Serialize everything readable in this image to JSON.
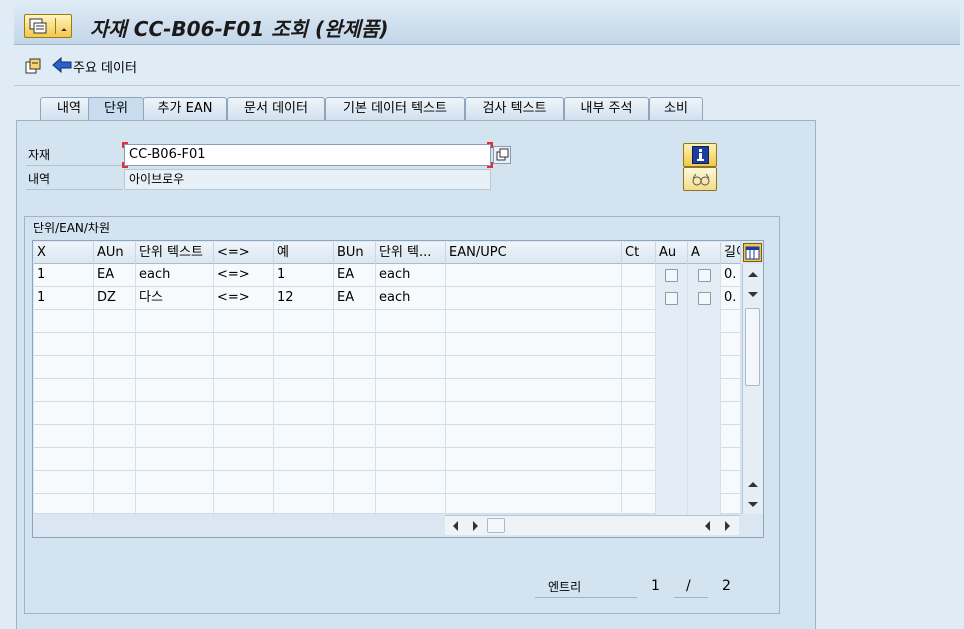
{
  "title": "자재 CC-B06-F01 조회 (완제품)",
  "toolbar": {
    "main_data_label": "주요 데이터"
  },
  "tabs": [
    {
      "label": "내역"
    },
    {
      "label": "단위"
    },
    {
      "label": "추가 EAN"
    },
    {
      "label": "문서 데이터"
    },
    {
      "label": "기본 데이터 텍스트"
    },
    {
      "label": "검사 텍스트"
    },
    {
      "label": "내부 주석"
    },
    {
      "label": "소비"
    }
  ],
  "active_tab": "단위",
  "fields": {
    "material_label": "자재",
    "material_value": "CC-B06-F01",
    "description_label": "내역",
    "description_value": "아이브로우"
  },
  "group": {
    "title": "단위/EAN/차원"
  },
  "table": {
    "columns": [
      "X",
      "AUn",
      "단위 텍스트",
      "<=>",
      "예",
      "BUn",
      "단위 텍...",
      "EAN/UPC",
      "Ct",
      "Au",
      "A",
      "길이"
    ],
    "rows": [
      [
        "1",
        "EA",
        "each",
        "<=>",
        "1",
        "EA",
        "each",
        "",
        "",
        "",
        "",
        "0."
      ],
      [
        "1",
        "DZ",
        "다스",
        "<=>",
        "12",
        "EA",
        "each",
        "",
        "",
        "",
        "",
        "0."
      ]
    ]
  },
  "entries": {
    "label": "엔트리",
    "current": "1",
    "separator": "/",
    "total": "2"
  },
  "colors": {
    "accent_gold": "#f1c94b",
    "info_blue": "#1b3ea0",
    "panel": "#d4e3f0"
  }
}
